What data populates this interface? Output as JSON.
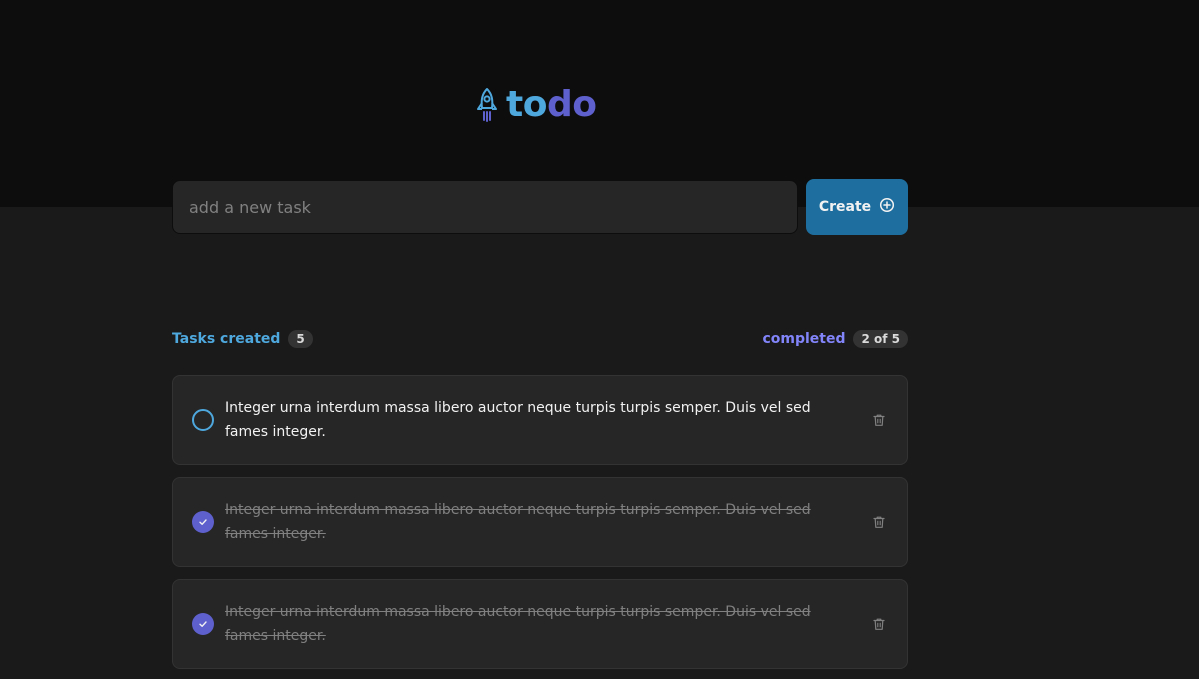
{
  "app": {
    "logo_part1": "to",
    "logo_part2": "do",
    "logo_icon": "rocket-icon"
  },
  "new_task": {
    "placeholder": "add a new task",
    "value": "",
    "create_label": "Create",
    "create_icon": "plus-circle-icon"
  },
  "stats": {
    "created_label": "Tasks created",
    "created_count": "5",
    "completed_label": "completed",
    "completed_count": "2 of 5"
  },
  "tasks": [
    {
      "text": "Integer urna interdum massa libero auctor neque turpis turpis semper. Duis vel sed fames integer.",
      "completed": false
    },
    {
      "text": "Integer urna interdum massa libero auctor neque turpis turpis semper. Duis vel sed fames integer.",
      "completed": true
    },
    {
      "text": "Integer urna interdum massa libero auctor neque turpis turpis semper. Duis vel sed fames integer.",
      "completed": true
    }
  ],
  "colors": {
    "blue": "#4ea8de",
    "blue_dark": "#1e6f9f",
    "purple": "#5e60ce",
    "purple_light": "#8284fa"
  }
}
